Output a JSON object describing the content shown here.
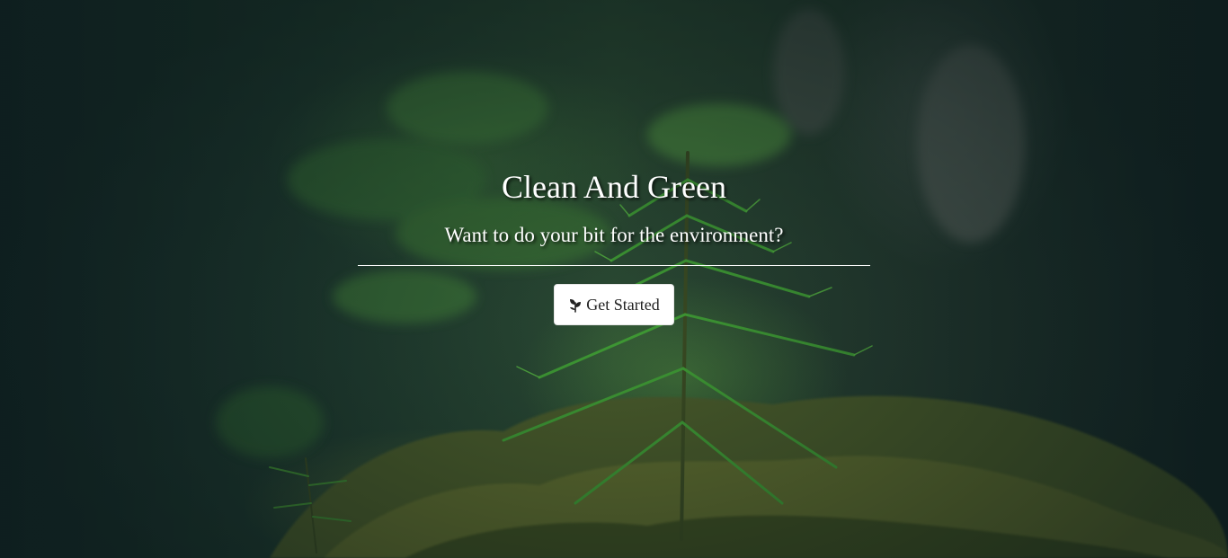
{
  "hero": {
    "title": "Clean And Green",
    "subtitle": "Want to do your bit for the environment?",
    "cta_label": "Get Started",
    "cta_icon": "seedling-icon",
    "background_image": "forest seedling photo"
  },
  "colors": {
    "text": "#ffffff",
    "button_bg": "#ffffff",
    "button_text": "#222222",
    "forest_dark": "#16292a",
    "forest_green": "#2b4a33"
  }
}
